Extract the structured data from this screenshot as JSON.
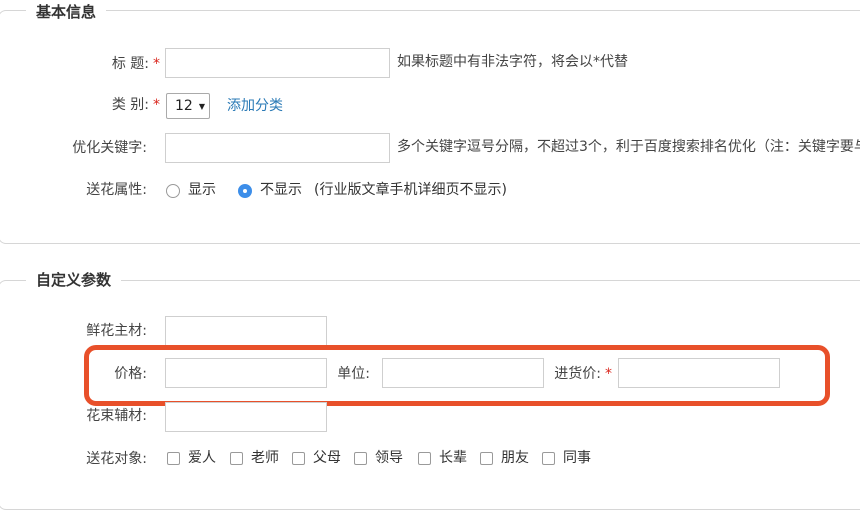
{
  "basic_info": {
    "legend": "基本信息",
    "title_label": "标 题:",
    "required_mark": "*",
    "title_value": "",
    "title_hint": "如果标题中有非法字符，将会以*代替",
    "category_label": "类 别:",
    "category_value": "12",
    "add_category_link": "添加分类",
    "keywords_label": "优化关键字:",
    "keywords_value": "",
    "keywords_hint": "多个关键字逗号分隔，不超过3个，利于百度搜索排名优化（注：关键字要与",
    "flower_attr_label": "送花属性:",
    "flower_attr_options": [
      {
        "label": "显示",
        "selected": false
      },
      {
        "label": "不显示",
        "selected": true
      }
    ],
    "flower_attr_note": "(行业版文章手机详细页不显示)"
  },
  "custom_params": {
    "legend": "自定义参数",
    "main_flower_label": "鲜花主材:",
    "main_flower_value": "",
    "price_label": "价格:",
    "price_value": "",
    "unit_label": "单位:",
    "unit_value": "",
    "purchase_price_label": "进货价:",
    "purchase_price_value": "",
    "aux_material_label": "花束辅材:",
    "aux_material_value": "",
    "recipient_label": "送花对象:",
    "recipient_options": [
      {
        "label": "爱人",
        "checked": false
      },
      {
        "label": "老师",
        "checked": false
      },
      {
        "label": "父母",
        "checked": false
      },
      {
        "label": "领导",
        "checked": false
      },
      {
        "label": "长辈",
        "checked": false
      },
      {
        "label": "朋友",
        "checked": false
      },
      {
        "label": "同事",
        "checked": false
      }
    ]
  },
  "colors": {
    "highlight": "#e8502a",
    "required": "#d9241b",
    "link": "#2a7ab6",
    "radio_selected": "#3d8ee9"
  }
}
